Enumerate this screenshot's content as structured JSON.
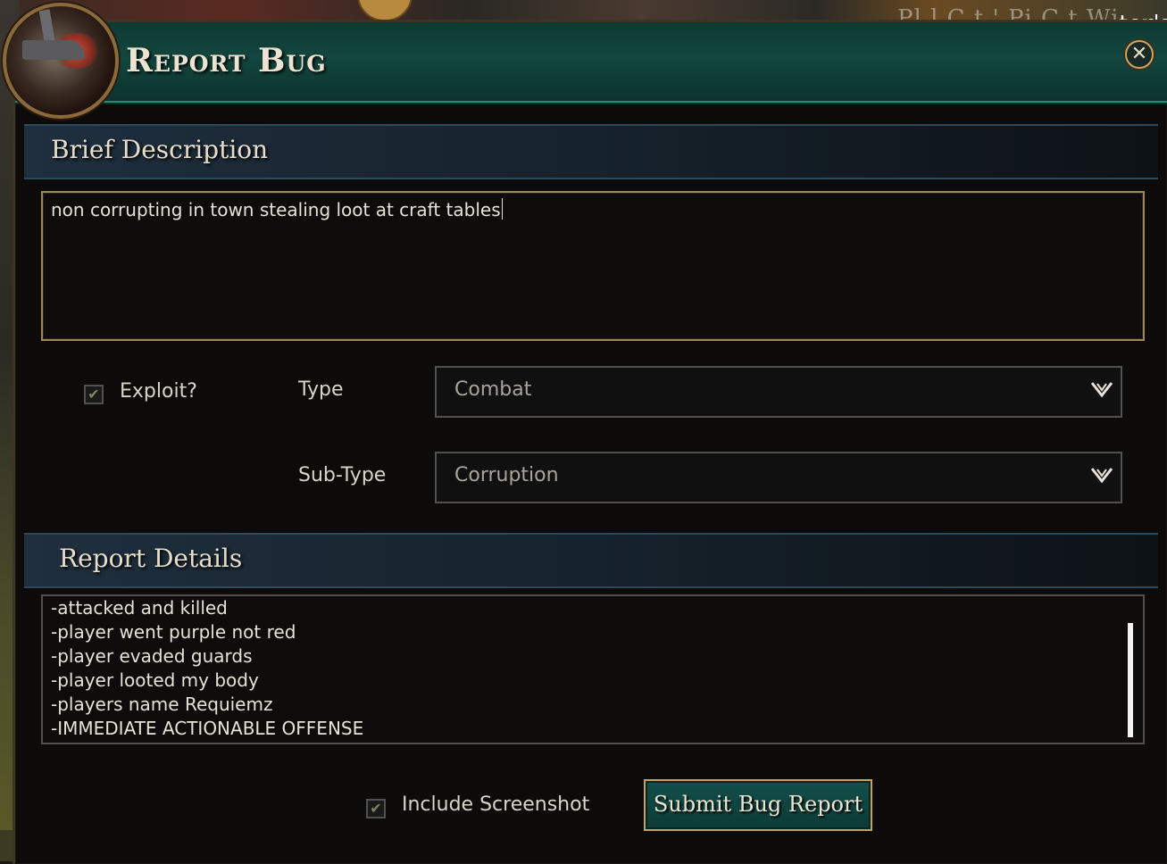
{
  "background": {
    "text_partial": "Pl   l  C  t    '  Pi  C t  Wi",
    "text_partial2": "tor's"
  },
  "dialog": {
    "title": "Report Bug",
    "close_icon": "close-icon"
  },
  "brief": {
    "heading": "Brief Description",
    "value": "non corrupting in town stealing loot at craft tables"
  },
  "exploit": {
    "label": "Exploit?",
    "checked": true
  },
  "type": {
    "label": "Type",
    "value": "Combat"
  },
  "subtype": {
    "label": "Sub-Type",
    "value": "Corruption"
  },
  "details": {
    "heading": "Report Details",
    "lines": [
      "-attacked and killed",
      "-player went purple not red",
      "-player evaded guards",
      "-player looted my body",
      "-players name Requiemz",
      "-IMMEDIATE ACTIONABLE OFFENSE"
    ]
  },
  "screenshot": {
    "label": "Include Screenshot",
    "checked": true
  },
  "submit": {
    "label": "Submit Bug Report"
  },
  "colors": {
    "title_bar": "#12463e",
    "accent_gold": "#c9a25a",
    "text": "#e6e2d8"
  }
}
